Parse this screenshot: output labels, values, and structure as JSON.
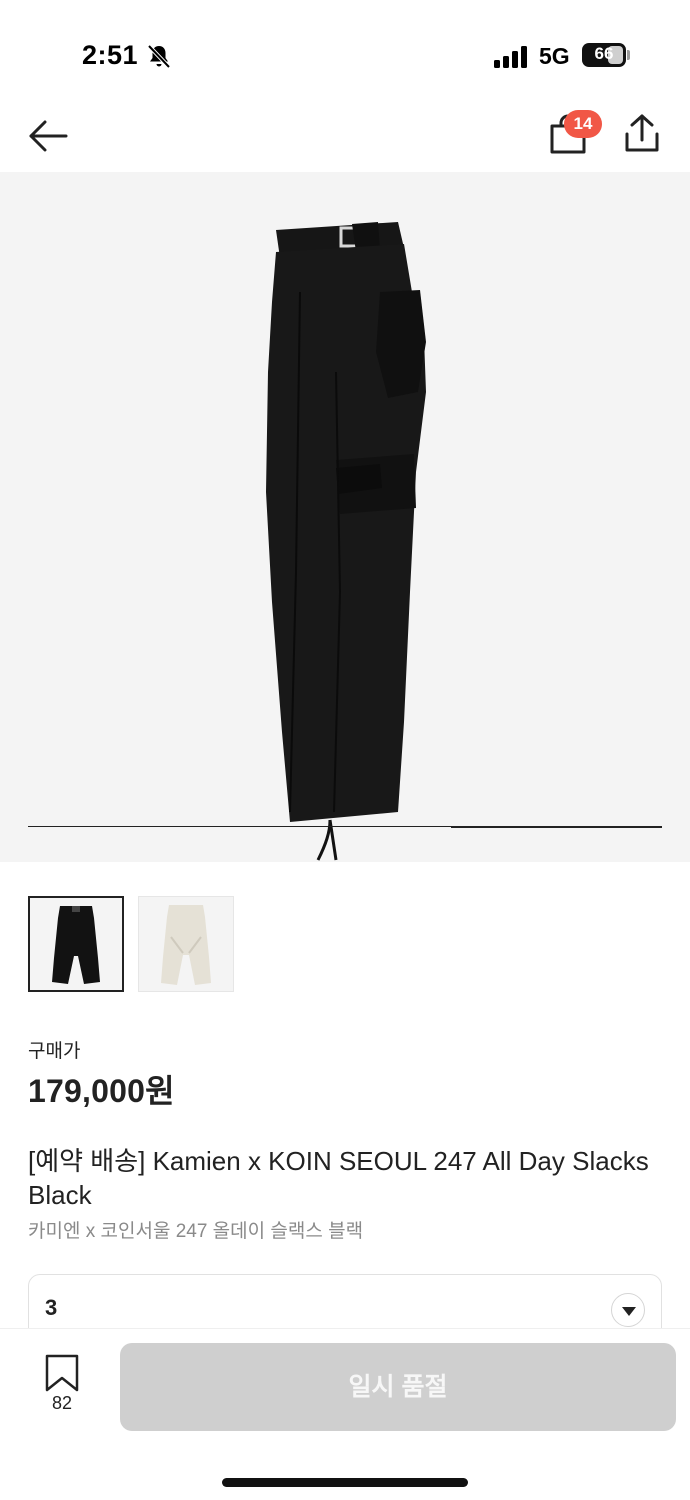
{
  "status_bar": {
    "time": "2:51",
    "network": "5G",
    "battery": "66",
    "battery_level_percent": 66
  },
  "nav": {
    "cart_count": "14"
  },
  "product": {
    "gallery": {
      "image_count": 2,
      "active_index": 2
    },
    "price_label": "구매가",
    "price": "179,000원",
    "title": "[예약 배송] Kamien x KOIN SEOUL 247 All Day Slacks Black",
    "subtitle": "카미엔 x 코인서울 247 올데이 슬랙스 블랙",
    "thumbnails": [
      {
        "color": "#111111",
        "selected": true
      },
      {
        "color": "#e5e1d6",
        "selected": false
      }
    ]
  },
  "size_select": {
    "value": "3"
  },
  "bottom_bar": {
    "wish_count": "82",
    "buy_label": "일시 품절"
  },
  "colors": {
    "badge": "#f15746",
    "buy_disabled": "#cfcfcf",
    "image_bg": "#f4f4f4"
  }
}
